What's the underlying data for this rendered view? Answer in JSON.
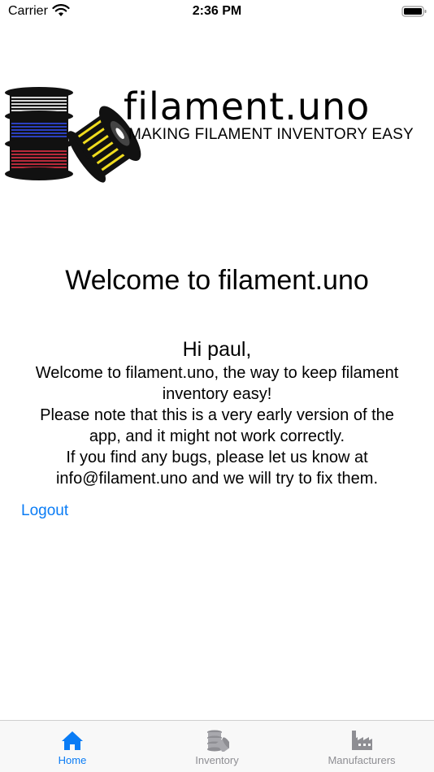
{
  "status_bar": {
    "carrier": "Carrier",
    "time": "2:36 PM",
    "wifi_icon": "wifi-icon",
    "battery_icon": "battery-icon"
  },
  "logo": {
    "wordmark": "filament.uno",
    "tagline": "MAKING FILAMENT INVENTORY EASY",
    "spool_colors": [
      "#d8d8d8",
      "#2b3fbf",
      "#b82a3a",
      "#f0dc1e"
    ]
  },
  "main": {
    "title": "Welcome to filament.uno",
    "greeting": "Hi paul,",
    "lines": [
      "Welcome to filament.uno, the way to keep filament",
      "inventory easy!",
      "Please note that this is a very early version of the",
      "app, and it might not work correctly.",
      "If you find any bugs, please let us know at",
      "info@filament.uno and we will try to fix them."
    ],
    "logout_label": "Logout"
  },
  "tab_bar": {
    "accent_color": "#0a7cf5",
    "tabs": [
      {
        "label": "Home",
        "icon": "house-icon",
        "active": true
      },
      {
        "label": "Inventory",
        "icon": "spool-stack-icon",
        "active": false
      },
      {
        "label": "Manufacturers",
        "icon": "factory-icon",
        "active": false
      }
    ]
  }
}
